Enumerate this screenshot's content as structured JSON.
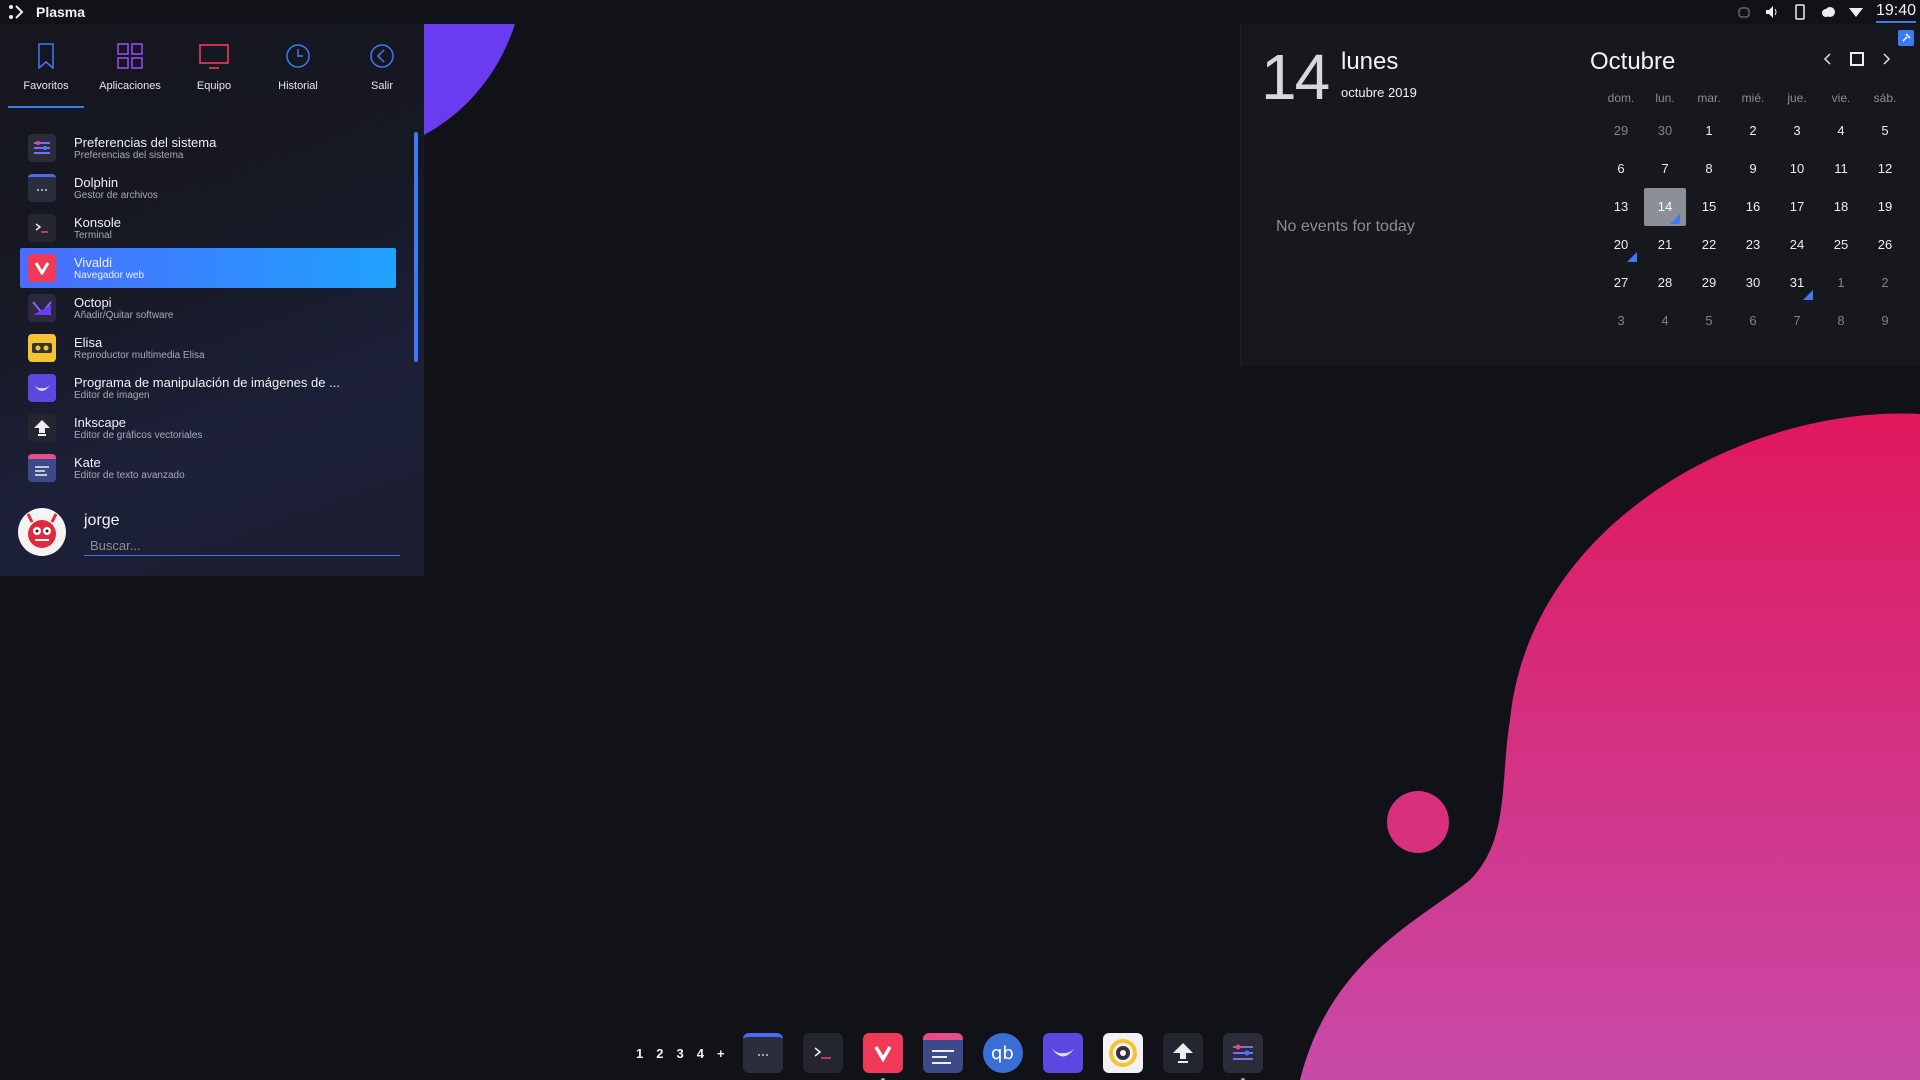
{
  "top_panel": {
    "title": "Plasma",
    "clock": "19:40"
  },
  "launcher": {
    "tabs": [
      {
        "label": "Favoritos",
        "icon": "bookmark-icon",
        "color": "#3d7bf5"
      },
      {
        "label": "Aplicaciones",
        "icon": "grid-icon",
        "color": "#9b4dff"
      },
      {
        "label": "Equipo",
        "icon": "monitor-icon",
        "color": "#ff3b5c"
      },
      {
        "label": "Historial",
        "icon": "clock-icon",
        "color": "#3d7bf5"
      },
      {
        "label": "Salir",
        "icon": "back-icon",
        "color": "#3d7bf5"
      }
    ],
    "apps": [
      {
        "name": "Preferencias del sistema",
        "desc": "Preferencias del sistema"
      },
      {
        "name": "Dolphin",
        "desc": "Gestor de archivos"
      },
      {
        "name": "Konsole",
        "desc": "Terminal"
      },
      {
        "name": "Vivaldi",
        "desc": "Navegador web"
      },
      {
        "name": "Octopi",
        "desc": "Añadir/Quitar software"
      },
      {
        "name": "Elisa",
        "desc": "Reproductor multimedia Elisa"
      },
      {
        "name": "Programa de manipulación de imágenes de ...",
        "desc": "Editor de imagen"
      },
      {
        "name": "Inkscape",
        "desc": "Editor de gráficos vectoriales"
      },
      {
        "name": "Kate",
        "desc": "Editor de texto avanzado"
      }
    ],
    "user": {
      "name": "jorge"
    },
    "search": {
      "placeholder": "Buscar..."
    }
  },
  "calendar": {
    "day": "14",
    "weekday": "lunes",
    "month_year": "octubre 2019",
    "no_events": "No events for today",
    "month": "Octubre",
    "weekdays": [
      "dom.",
      "lun.",
      "mar.",
      "mié.",
      "jue.",
      "vie.",
      "sáb."
    ],
    "weeks": [
      [
        "29",
        "30",
        "1",
        "2",
        "3",
        "4",
        "5"
      ],
      [
        "6",
        "7",
        "8",
        "9",
        "10",
        "11",
        "12"
      ],
      [
        "13",
        "14",
        "15",
        "16",
        "17",
        "18",
        "19"
      ],
      [
        "20",
        "21",
        "22",
        "23",
        "24",
        "25",
        "26"
      ],
      [
        "27",
        "28",
        "29",
        "30",
        "31",
        "1",
        "2"
      ],
      [
        "3",
        "4",
        "5",
        "6",
        "7",
        "8",
        "9"
      ]
    ]
  },
  "taskbar": {
    "desktops": [
      "1",
      "2",
      "3",
      "4",
      "+"
    ],
    "tasks": [
      "dolphin-icon",
      "konsole-icon",
      "vivaldi-icon",
      "kate-icon",
      "qbittorrent-icon",
      "gimp-icon",
      "gnome-disks-icon",
      "inkscape-icon",
      "system-settings-icon"
    ]
  }
}
